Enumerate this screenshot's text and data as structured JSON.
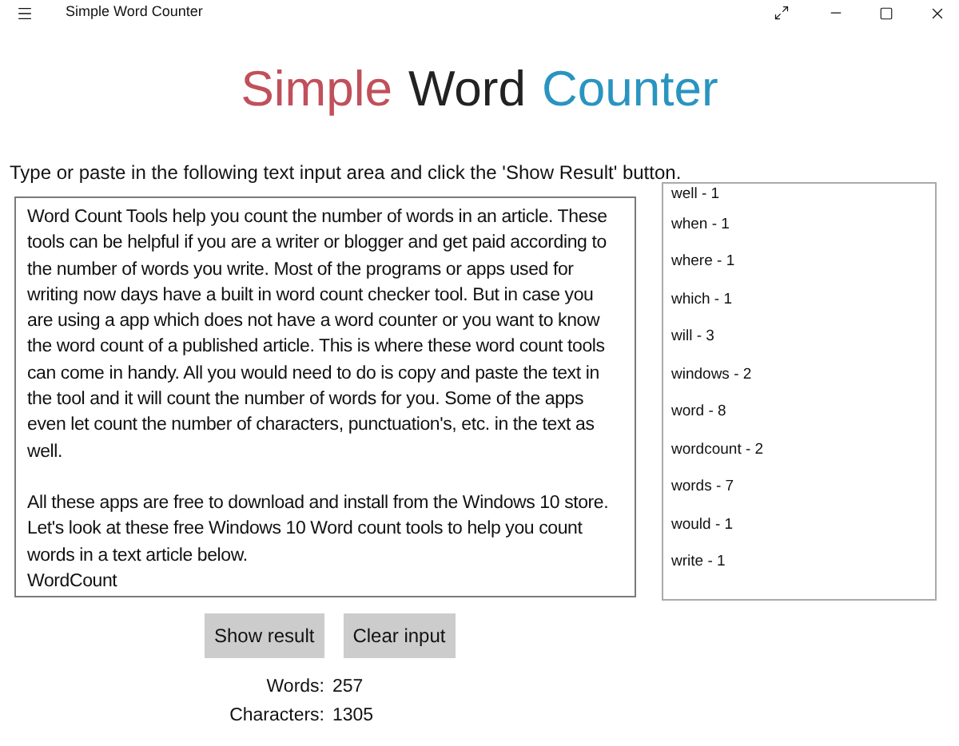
{
  "window": {
    "title": "Simple Word Counter"
  },
  "heading": [
    {
      "text": "Simple",
      "color": "#c0505a"
    },
    {
      "text": "Word",
      "color": "#222222"
    },
    {
      "text": "Counter",
      "color": "#2a94c0"
    }
  ],
  "instruction": "Type or paste in the following text input area and click the 'Show Result' button.",
  "input": {
    "paragraphs": [
      [
        "Word Count Tools help you count the number of words in an article. These tools can be helpful if you are a writer or blogger and get paid according to the number of words you write. Most of the programs or apps used for writing now days have a built in word count checker tool. But in case you are using a app which does not have a word counter or you want to know the word count of a published article. This is where these word count tools can come in handy. All you would need to do is copy and paste the text in the tool and it will count the number of words for you. Some of the apps even let count the number of characters, punctuation's, etc. in the text as well."
      ],
      [
        "All these apps are free to download and install from the Windows 10 store. Let's look at these free Windows 10 Word count tools to help you count words in a text article below.",
        "WordCount"
      ]
    ]
  },
  "results": [
    "well - 1",
    "when - 1",
    "where - 1",
    "which - 1",
    "will - 3",
    "windows - 2",
    "word - 8",
    "wordcount - 2",
    "words - 7",
    "would - 1",
    "write - 1"
  ],
  "buttons": [
    "Show result",
    "Clear input"
  ],
  "stats": [
    {
      "label": "Words:",
      "value": "257"
    },
    {
      "label": "Characters:",
      "value": "1305"
    }
  ]
}
